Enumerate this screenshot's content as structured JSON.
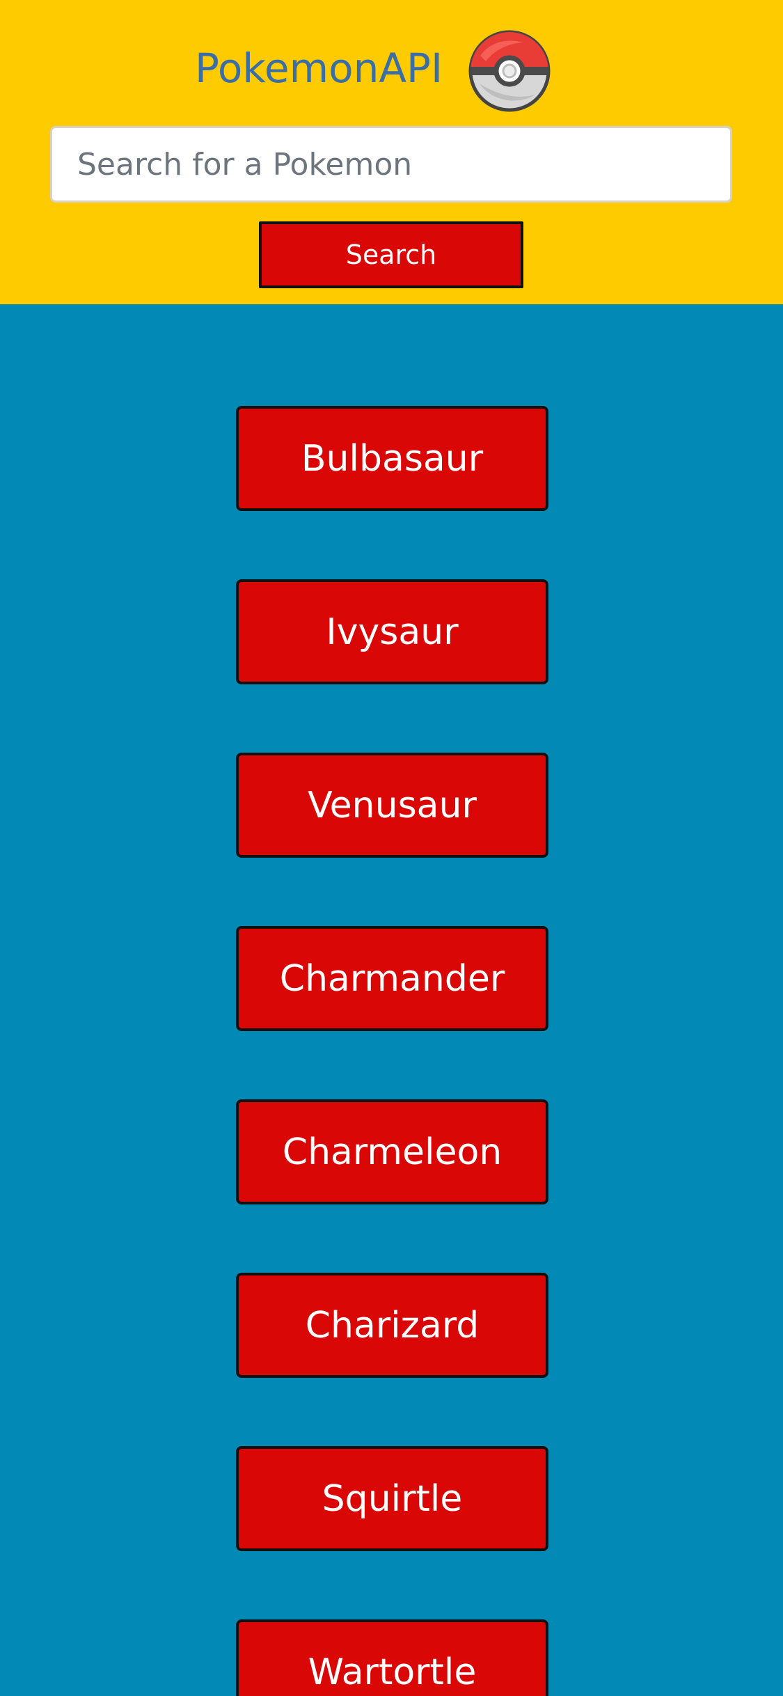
{
  "header": {
    "title": "PokemonAPI",
    "logo_icon": "pokeball-icon",
    "background_color": "#fecb00",
    "title_color": "#3b6ea5"
  },
  "search": {
    "placeholder": "Search for a Pokemon",
    "value": "",
    "button_label": "Search"
  },
  "pokemon_list": {
    "background_color": "#0389b5",
    "button_color": "#da0707",
    "items": [
      {
        "label": "Bulbasaur"
      },
      {
        "label": "Ivysaur"
      },
      {
        "label": "Venusaur"
      },
      {
        "label": "Charmander"
      },
      {
        "label": "Charmeleon"
      },
      {
        "label": "Charizard"
      },
      {
        "label": "Squirtle"
      },
      {
        "label": "Wartortle"
      }
    ]
  }
}
